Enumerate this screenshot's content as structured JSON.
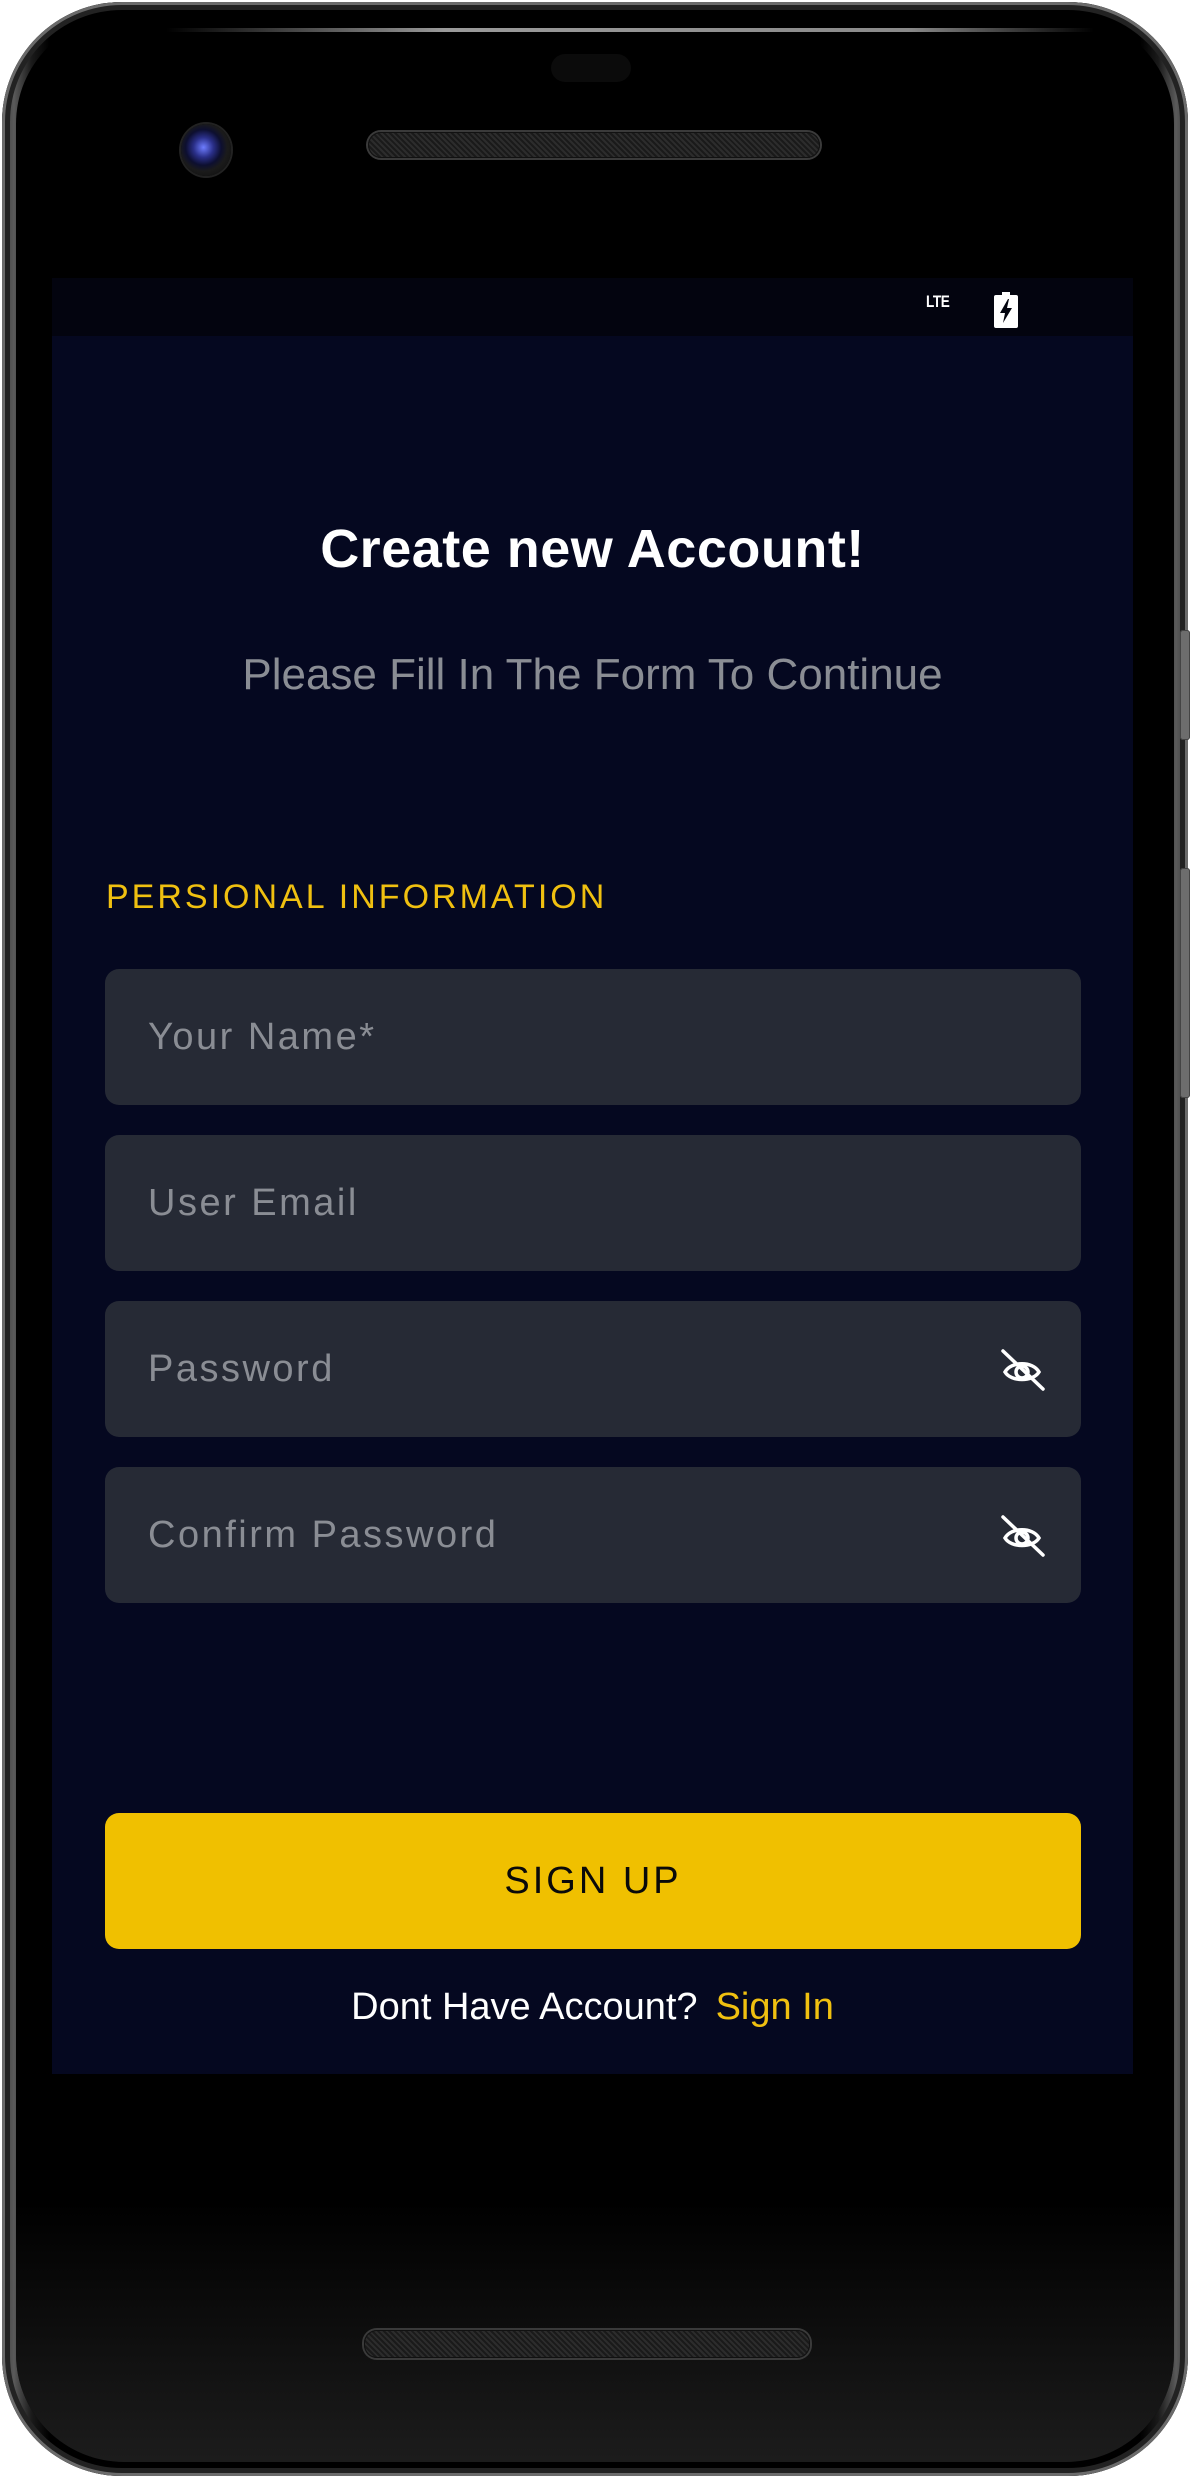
{
  "status_bar": {
    "network": "LTE",
    "battery_icon": "battery-charging-icon"
  },
  "header": {
    "title": "Create new Account!",
    "subtitle": "Please Fill In The Form To Continue"
  },
  "form": {
    "section_label": "PERSIONAL INFORMATION",
    "fields": [
      {
        "name": "name",
        "placeholder": "Your Name*",
        "value": "",
        "type": "text"
      },
      {
        "name": "email",
        "placeholder": "User Email",
        "value": "",
        "type": "email"
      },
      {
        "name": "password",
        "placeholder": "Password",
        "value": "",
        "type": "password",
        "toggle_icon": "eye-off-icon"
      },
      {
        "name": "confirm_password",
        "placeholder": "Confirm Password",
        "value": "",
        "type": "password",
        "toggle_icon": "eye-off-icon"
      }
    ],
    "submit_label": "SIGN UP"
  },
  "footer": {
    "prompt": "Dont Have Account?",
    "link_label": "Sign In"
  },
  "colors": {
    "background": "#050820",
    "field_background": "#262a35",
    "accent": "#f0c000",
    "placeholder": "#8a8d94",
    "text": "#ffffff"
  }
}
